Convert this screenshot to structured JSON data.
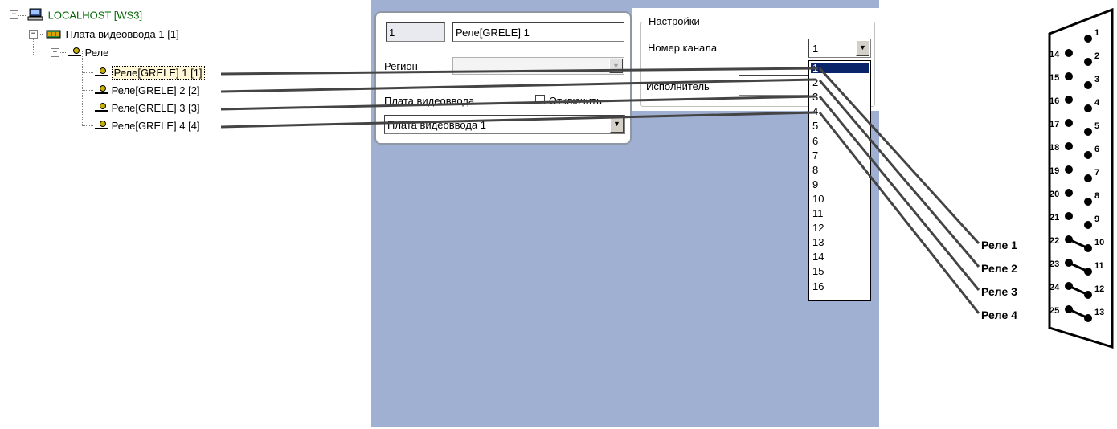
{
  "tree": {
    "root_label": "LOCALHOST [WS3]",
    "board_label": "Плата видеоввода 1 [1]",
    "relay_group_label": "Реле",
    "relays": [
      {
        "label": "Реле[GRELE] 1 [1]"
      },
      {
        "label": "Реле[GRELE] 2 [2]"
      },
      {
        "label": "Реле[GRELE] 3 [3]"
      },
      {
        "label": "Реле[GRELE] 4 [4]"
      }
    ],
    "expander_symbol": "−"
  },
  "card": {
    "id_value": "1",
    "name_value": "Реле[GRELE] 1",
    "region_label": "Регион",
    "region_value": "",
    "board_label": "Плата видеоввода",
    "disable_label": "Отключить",
    "board_value": "Плата видеоввода 1"
  },
  "settings": {
    "group_title": "Настройки",
    "channel_label": "Номер канала",
    "channel_value": "1",
    "executor_label": "Исполнитель",
    "channel_options": [
      "1",
      "2",
      "3",
      "4",
      "5",
      "6",
      "7",
      "8",
      "9",
      "10",
      "11",
      "12",
      "13",
      "14",
      "15",
      "16"
    ],
    "selected_index": 0
  },
  "connector": {
    "relay_labels": [
      "Реле 1",
      "Реле 2",
      "Реле 3",
      "Реле 4"
    ],
    "pins_right": [
      "1",
      "2",
      "3",
      "4",
      "5",
      "6",
      "7",
      "8",
      "9",
      "10",
      "11",
      "12",
      "13"
    ],
    "pins_left": [
      "14",
      "15",
      "16",
      "17",
      "18",
      "19",
      "20",
      "21",
      "22",
      "23",
      "24",
      "25"
    ]
  },
  "colors": {
    "panel_bg": "#9fb0d3",
    "tree_root": "#006400",
    "selection": "#0a246a"
  },
  "icons": {
    "computer": "computer-icon",
    "board": "board-icon",
    "relay": "relay-icon",
    "dropdown": "chevron-down-icon"
  }
}
